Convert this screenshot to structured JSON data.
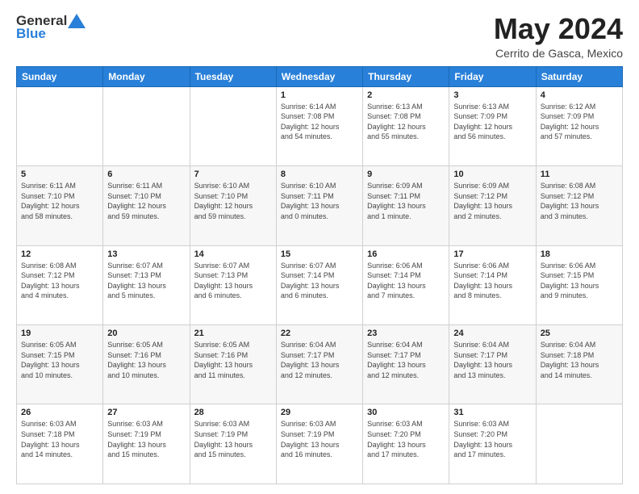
{
  "header": {
    "logo_general": "General",
    "logo_blue": "Blue",
    "month": "May 2024",
    "location": "Cerrito de Gasca, Mexico"
  },
  "days_of_week": [
    "Sunday",
    "Monday",
    "Tuesday",
    "Wednesday",
    "Thursday",
    "Friday",
    "Saturday"
  ],
  "weeks": [
    [
      {
        "day": "",
        "info": ""
      },
      {
        "day": "",
        "info": ""
      },
      {
        "day": "",
        "info": ""
      },
      {
        "day": "1",
        "info": "Sunrise: 6:14 AM\nSunset: 7:08 PM\nDaylight: 12 hours\nand 54 minutes."
      },
      {
        "day": "2",
        "info": "Sunrise: 6:13 AM\nSunset: 7:08 PM\nDaylight: 12 hours\nand 55 minutes."
      },
      {
        "day": "3",
        "info": "Sunrise: 6:13 AM\nSunset: 7:09 PM\nDaylight: 12 hours\nand 56 minutes."
      },
      {
        "day": "4",
        "info": "Sunrise: 6:12 AM\nSunset: 7:09 PM\nDaylight: 12 hours\nand 57 minutes."
      }
    ],
    [
      {
        "day": "5",
        "info": "Sunrise: 6:11 AM\nSunset: 7:10 PM\nDaylight: 12 hours\nand 58 minutes."
      },
      {
        "day": "6",
        "info": "Sunrise: 6:11 AM\nSunset: 7:10 PM\nDaylight: 12 hours\nand 59 minutes."
      },
      {
        "day": "7",
        "info": "Sunrise: 6:10 AM\nSunset: 7:10 PM\nDaylight: 12 hours\nand 59 minutes."
      },
      {
        "day": "8",
        "info": "Sunrise: 6:10 AM\nSunset: 7:11 PM\nDaylight: 13 hours\nand 0 minutes."
      },
      {
        "day": "9",
        "info": "Sunrise: 6:09 AM\nSunset: 7:11 PM\nDaylight: 13 hours\nand 1 minute."
      },
      {
        "day": "10",
        "info": "Sunrise: 6:09 AM\nSunset: 7:12 PM\nDaylight: 13 hours\nand 2 minutes."
      },
      {
        "day": "11",
        "info": "Sunrise: 6:08 AM\nSunset: 7:12 PM\nDaylight: 13 hours\nand 3 minutes."
      }
    ],
    [
      {
        "day": "12",
        "info": "Sunrise: 6:08 AM\nSunset: 7:12 PM\nDaylight: 13 hours\nand 4 minutes."
      },
      {
        "day": "13",
        "info": "Sunrise: 6:07 AM\nSunset: 7:13 PM\nDaylight: 13 hours\nand 5 minutes."
      },
      {
        "day": "14",
        "info": "Sunrise: 6:07 AM\nSunset: 7:13 PM\nDaylight: 13 hours\nand 6 minutes."
      },
      {
        "day": "15",
        "info": "Sunrise: 6:07 AM\nSunset: 7:14 PM\nDaylight: 13 hours\nand 6 minutes."
      },
      {
        "day": "16",
        "info": "Sunrise: 6:06 AM\nSunset: 7:14 PM\nDaylight: 13 hours\nand 7 minutes."
      },
      {
        "day": "17",
        "info": "Sunrise: 6:06 AM\nSunset: 7:14 PM\nDaylight: 13 hours\nand 8 minutes."
      },
      {
        "day": "18",
        "info": "Sunrise: 6:06 AM\nSunset: 7:15 PM\nDaylight: 13 hours\nand 9 minutes."
      }
    ],
    [
      {
        "day": "19",
        "info": "Sunrise: 6:05 AM\nSunset: 7:15 PM\nDaylight: 13 hours\nand 10 minutes."
      },
      {
        "day": "20",
        "info": "Sunrise: 6:05 AM\nSunset: 7:16 PM\nDaylight: 13 hours\nand 10 minutes."
      },
      {
        "day": "21",
        "info": "Sunrise: 6:05 AM\nSunset: 7:16 PM\nDaylight: 13 hours\nand 11 minutes."
      },
      {
        "day": "22",
        "info": "Sunrise: 6:04 AM\nSunset: 7:17 PM\nDaylight: 13 hours\nand 12 minutes."
      },
      {
        "day": "23",
        "info": "Sunrise: 6:04 AM\nSunset: 7:17 PM\nDaylight: 13 hours\nand 12 minutes."
      },
      {
        "day": "24",
        "info": "Sunrise: 6:04 AM\nSunset: 7:17 PM\nDaylight: 13 hours\nand 13 minutes."
      },
      {
        "day": "25",
        "info": "Sunrise: 6:04 AM\nSunset: 7:18 PM\nDaylight: 13 hours\nand 14 minutes."
      }
    ],
    [
      {
        "day": "26",
        "info": "Sunrise: 6:03 AM\nSunset: 7:18 PM\nDaylight: 13 hours\nand 14 minutes."
      },
      {
        "day": "27",
        "info": "Sunrise: 6:03 AM\nSunset: 7:19 PM\nDaylight: 13 hours\nand 15 minutes."
      },
      {
        "day": "28",
        "info": "Sunrise: 6:03 AM\nSunset: 7:19 PM\nDaylight: 13 hours\nand 15 minutes."
      },
      {
        "day": "29",
        "info": "Sunrise: 6:03 AM\nSunset: 7:19 PM\nDaylight: 13 hours\nand 16 minutes."
      },
      {
        "day": "30",
        "info": "Sunrise: 6:03 AM\nSunset: 7:20 PM\nDaylight: 13 hours\nand 17 minutes."
      },
      {
        "day": "31",
        "info": "Sunrise: 6:03 AM\nSunset: 7:20 PM\nDaylight: 13 hours\nand 17 minutes."
      },
      {
        "day": "",
        "info": ""
      }
    ]
  ]
}
